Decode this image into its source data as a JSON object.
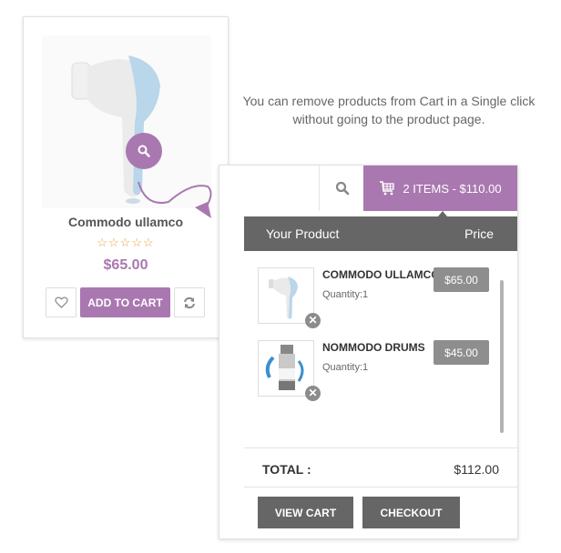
{
  "product": {
    "title": "Commodo ullamco",
    "rating_stars": "☆☆☆☆☆",
    "rating": 0,
    "price": "$65.00",
    "add_to_cart_label": "ADD TO CART",
    "icons": {
      "zoom": "search-icon",
      "wishlist": "heart-icon",
      "compare": "refresh-icon"
    }
  },
  "tip": {
    "text": "You can remove products from Cart in a Single click without going to the product page."
  },
  "cart": {
    "summary": "2 ITEMS - $110.00",
    "header": {
      "product": "Your Product",
      "price": "Price"
    },
    "items": [
      {
        "name": "COMMODO ULLAMCO",
        "quantity": "Quantity:1",
        "price": "$65.00",
        "thumb": "facial-brush"
      },
      {
        "name": "NOMMODO DRUMS",
        "quantity": "Quantity:1",
        "price": "$45.00",
        "thumb": "serum-bottle"
      }
    ],
    "remove_glyph": "✕",
    "total_label": "TOTAL :",
    "total_value": "$112.00",
    "view_cart_label": "VIEW CART",
    "checkout_label": "CHECKOUT"
  },
  "colors": {
    "accent": "#a978b0",
    "dark_gray": "#666666",
    "price_badge": "#8e8e8e",
    "star": "#e8a23a"
  }
}
